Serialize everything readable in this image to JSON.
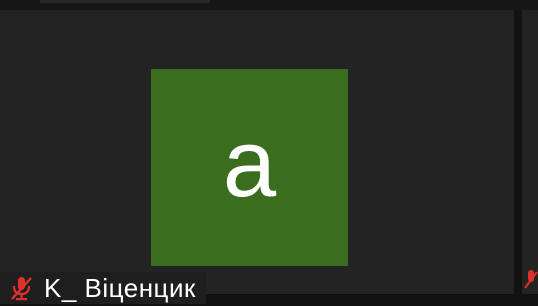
{
  "participant": {
    "avatar_letter": "a",
    "name": "K_ Віценцик",
    "mic_status_icon": "mic-muted-icon",
    "avatar_color": "#3b6d1e"
  },
  "colors": {
    "tile_background": "#232323",
    "muted_icon": "#e0302a"
  }
}
